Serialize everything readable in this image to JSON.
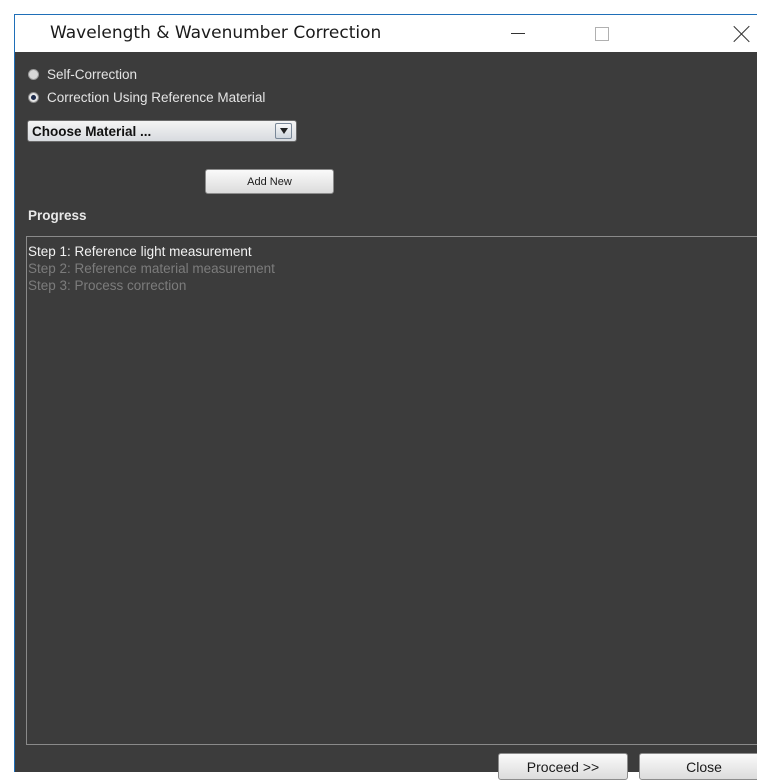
{
  "window": {
    "title": "Wavelength & Wavenumber Correction"
  },
  "options": {
    "self_correction_label": "Self-Correction",
    "reference_correction_label": "Correction Using Reference Material",
    "selected": "reference_correction"
  },
  "material_select": {
    "selected_value": "Choose Material ..."
  },
  "add_new_label": "Add New",
  "progress": {
    "heading": "Progress",
    "steps": [
      {
        "label": "Step 1: Reference light measurement",
        "state": "active"
      },
      {
        "label": "Step 2: Reference material measurement",
        "state": "pending"
      },
      {
        "label": "Step 3: Process correction",
        "state": "pending"
      }
    ]
  },
  "footer": {
    "proceed_label": "Proceed >>",
    "close_label": "Close"
  },
  "icons": {
    "minimize": "minimize-icon",
    "maximize": "maximize-icon",
    "close": "close-icon",
    "dropdown": "chevron-down-icon"
  },
  "colors": {
    "background": "#3c3c3c",
    "active_step": "#f2f2f2",
    "pending_step": "#7c7c7c",
    "window_border": "#1f6fb8"
  }
}
